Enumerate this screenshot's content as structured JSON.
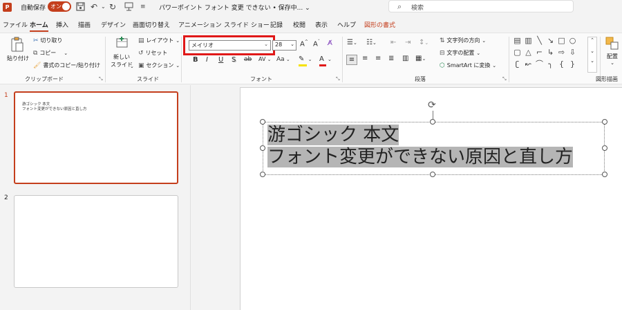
{
  "titlebar": {
    "app_logo": "P",
    "autosave_label": "自動保存",
    "autosave_toggle": "オン",
    "document_title": "パワーポイント フォント 変更 できない • 保存中...",
    "title_dropdown": "⌄",
    "search_placeholder": "検索",
    "qat_icons": [
      "save-icon",
      "undo-icon",
      "redo-icon",
      "slideshow-icon",
      "customize-icon"
    ]
  },
  "tabs": [
    {
      "label": "ファイル"
    },
    {
      "label": "ホーム",
      "active": true
    },
    {
      "label": "挿入"
    },
    {
      "label": "描画"
    },
    {
      "label": "デザイン"
    },
    {
      "label": "画面切り替え"
    },
    {
      "label": "アニメーション"
    },
    {
      "label": "スライド ショー"
    },
    {
      "label": "記録"
    },
    {
      "label": "校閲"
    },
    {
      "label": "表示"
    },
    {
      "label": "ヘルプ"
    },
    {
      "label": "図形の書式",
      "contextual": true
    }
  ],
  "ribbon": {
    "clipboard": {
      "paste_label": "貼り付け",
      "cut_label": "切り取り",
      "copy_label": "コピー",
      "format_painter_label": "書式のコピー/貼り付け",
      "group_label": "クリップボード"
    },
    "slides": {
      "new_slide_label_1": "新しい",
      "new_slide_label_2": "スライド",
      "layout_label": "レイアウト",
      "reset_label": "リセット",
      "section_label": "セクション",
      "group_label": "スライド"
    },
    "font": {
      "font_name": "メイリオ",
      "font_size": "28",
      "bold": "B",
      "italic": "I",
      "underline": "U",
      "shadow": "S",
      "strikethrough": "ab",
      "spacing": "AV",
      "change_case": "Aa",
      "group_label": "フォント",
      "highlight_color": "#f5e100",
      "font_color": "#e01818"
    },
    "paragraph": {
      "text_direction_label": "文字列の方向",
      "align_text_label": "文字の配置",
      "smartart_label": "SmartArt に変換",
      "group_label": "段落"
    },
    "drawing": {
      "arrange_label": "配置",
      "group_label": "図形描画"
    }
  },
  "slides_panel": {
    "slides": [
      {
        "number": "1",
        "line1": "游ゴシック 本文",
        "line2": "フォント変更ができない原因と直し方",
        "selected": true
      },
      {
        "number": "2",
        "selected": false
      }
    ]
  },
  "canvas": {
    "textbox_line1": "游ゴシック 本文",
    "textbox_line2": "フォント変更ができない原因と直し方"
  },
  "colors": {
    "accent": "#c43e1c",
    "highlight_box": "#e01818",
    "text_selection": "#b5b5b5"
  }
}
